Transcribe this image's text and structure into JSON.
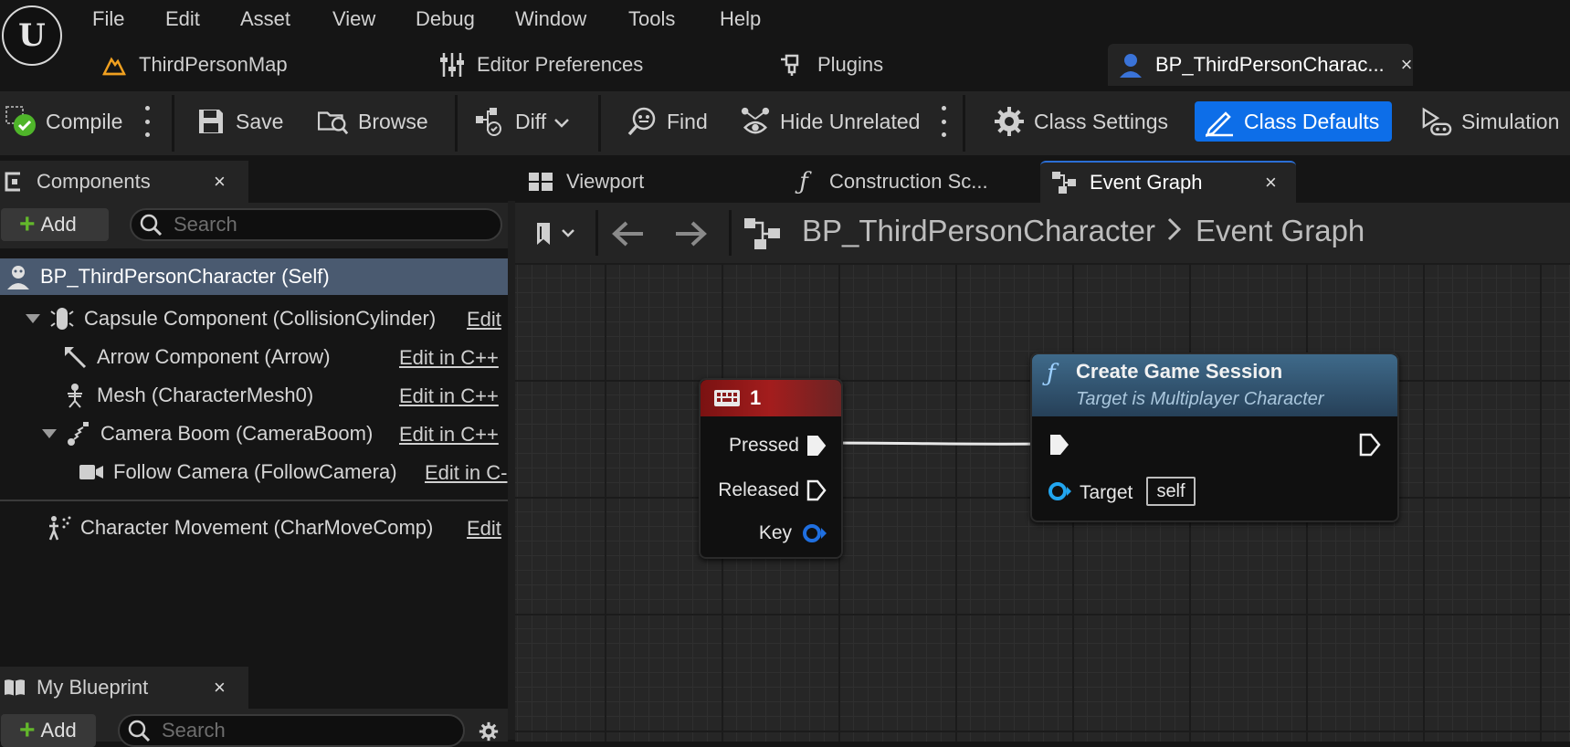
{
  "menu": {
    "logo": "U",
    "items": [
      "File",
      "Edit",
      "Asset",
      "View",
      "Debug",
      "Window",
      "Tools",
      "Help"
    ]
  },
  "doc_tabs": [
    {
      "label": "ThirdPersonMap",
      "icon": "level-icon"
    },
    {
      "label": "Editor Preferences",
      "icon": "sliders-icon"
    },
    {
      "label": "Plugins",
      "icon": "plug-icon"
    },
    {
      "label": "BP_ThirdPersonCharac...",
      "icon": "character-icon",
      "active": true,
      "close": "×"
    }
  ],
  "toolbar": {
    "compile": "Compile",
    "save": "Save",
    "browse": "Browse",
    "diff": "Diff",
    "find": "Find",
    "hide_unrelated": "Hide Unrelated",
    "class_settings": "Class Settings",
    "class_defaults": "Class Defaults",
    "simulation": "Simulation",
    "accent_color": "#0d6ee8"
  },
  "components_panel": {
    "title": "Components",
    "close": "×",
    "add": "Add",
    "search_placeholder": "Search",
    "tree": [
      {
        "label": "BP_ThirdPersonCharacter (Self)",
        "icon": "character-icon",
        "selected": true
      },
      {
        "label": "Capsule Component (CollisionCylinder)",
        "icon": "capsule-icon",
        "edit": "Edit"
      },
      {
        "label": "Arrow Component (Arrow)",
        "icon": "arrow-icon",
        "edit": "Edit in C++"
      },
      {
        "label": "Mesh (CharacterMesh0)",
        "icon": "skeleton-icon",
        "edit": "Edit in C++"
      },
      {
        "label": "Camera Boom (CameraBoom)",
        "icon": "spring-arm-icon",
        "edit": "Edit in C++"
      },
      {
        "label": "Follow Camera (FollowCamera)",
        "icon": "camera-icon",
        "edit": "Edit in C-"
      },
      {
        "label": "Character Movement (CharMoveComp)",
        "icon": "movement-icon",
        "edit": "Edit"
      }
    ]
  },
  "my_blueprint_panel": {
    "title": "My Blueprint",
    "close": "×",
    "add": "Add",
    "search_placeholder": "Search"
  },
  "graph_tabs": [
    {
      "label": "Viewport",
      "icon": "viewport-icon"
    },
    {
      "label": "Construction Sc...",
      "icon": "function-icon"
    },
    {
      "label": "Event Graph",
      "icon": "graph-icon",
      "active": true,
      "close": "×"
    }
  ],
  "breadcrumb": {
    "blueprint": "BP_ThirdPersonCharacter",
    "separator": ">",
    "graph": "Event Graph"
  },
  "nodes": {
    "key_event": {
      "title": "1",
      "pins": [
        "Pressed",
        "Released",
        "Key"
      ],
      "header_color": "#a31d1d"
    },
    "function_call": {
      "title": "Create Game Session",
      "subtitle": "Target is Multiplayer Character",
      "target_label": "Target",
      "target_value": "self",
      "header_color": "#3f6a8a"
    }
  }
}
